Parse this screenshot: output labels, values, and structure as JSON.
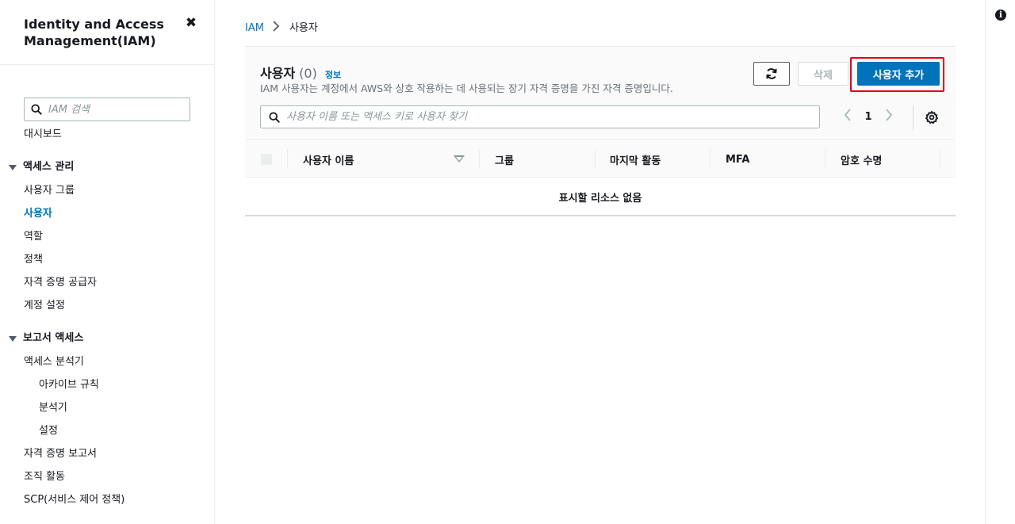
{
  "sidebar": {
    "title": "Identity and Access Management(IAM)",
    "search_placeholder": "IAM 검색",
    "dashboard": "대시보드",
    "section_access": "액세스 관리",
    "access_items": [
      "사용자 그룹",
      "사용자",
      "역할",
      "정책",
      "자격 증명 공급자",
      "계정 설정"
    ],
    "section_reports": "보고서 액세스",
    "analyzer": "액세스 분석기",
    "analyzer_subitems": [
      "아카이브 규칙",
      "분석기",
      "설정"
    ],
    "report_items": [
      "자격 증명 보고서",
      "조직 활동",
      "SCP(서비스 제어 정책)"
    ],
    "active_item": "사용자"
  },
  "breadcrumb": {
    "root": "IAM",
    "current": "사용자"
  },
  "panel": {
    "title": "사용자",
    "count": "(0)",
    "info_link": "정보",
    "description": "IAM 사용자는 계정에서 AWS와 상호 작용하는 데 사용되는 장기 자격 증명을 가진 자격 증명입니다.",
    "delete_label": "삭제",
    "add_user_label": "사용자 추가",
    "search_placeholder": "사용자 이름 또는 액세스 키로 사용자 찾기",
    "page_number": "1"
  },
  "table": {
    "columns": [
      "사용자 이름",
      "그룹",
      "마지막 활동",
      "MFA",
      "암호 수명"
    ],
    "empty_message": "표시할 리소스 없음"
  },
  "colors": {
    "link": "#0073bb",
    "primary_button": "#0073bb",
    "highlight_border": "#e3001b"
  },
  "icons": {
    "close": "close-icon",
    "search": "search-icon",
    "refresh": "refresh-icon",
    "settings": "gear-icon",
    "info": "info-icon"
  }
}
